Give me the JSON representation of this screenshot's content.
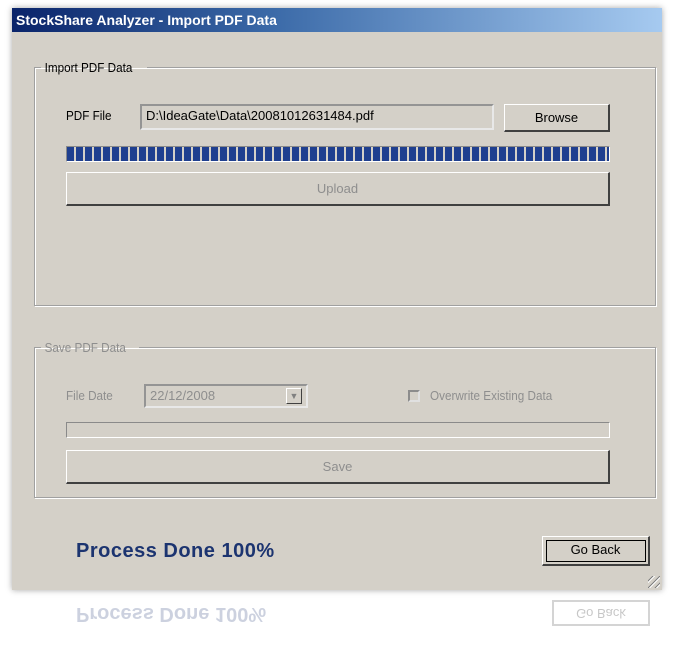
{
  "window": {
    "title": "StockShare Analyzer  - Import PDF Data"
  },
  "import_group": {
    "legend": "Import PDF Data",
    "pdf_file_label": "PDF File",
    "pdf_file_value": "D:\\IdeaGate\\Data\\20081012631484.pdf",
    "browse_label": "Browse",
    "progress_percent": 100,
    "upload_label": "Upload"
  },
  "save_group": {
    "legend": "Save PDF Data",
    "file_date_label": "File Date",
    "file_date_value": "22/12/2008",
    "overwrite_label": "Overwrite Existing Data",
    "progress_percent": 0,
    "save_label": "Save"
  },
  "footer": {
    "status_text": "Process Done 100%",
    "go_back_label": "Go Back"
  },
  "colors": {
    "title_gradient_start": "#0a246a",
    "progress_fill": "#1f3f8f",
    "status_text": "#1c3470"
  }
}
